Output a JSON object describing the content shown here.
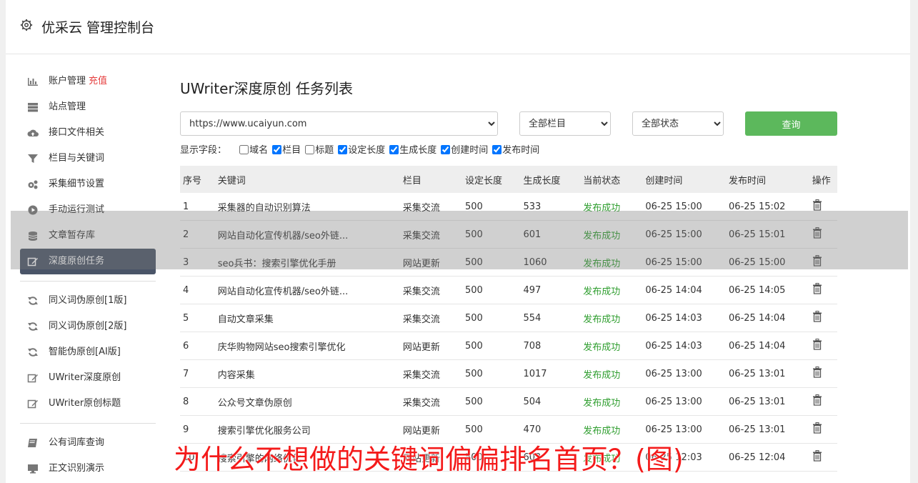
{
  "header": {
    "title": "优采云 管理控制台",
    "icon": "gear-icon"
  },
  "sidebar": {
    "group1": [
      {
        "label": "账户管理",
        "extra": "充值",
        "icon": "bar-chart-icon"
      },
      {
        "label": "站点管理",
        "icon": "server-icon"
      },
      {
        "label": "接口文件相关",
        "icon": "cloud-upload-icon"
      },
      {
        "label": "栏目与关键词",
        "icon": "filter-icon"
      },
      {
        "label": "采集细节设置",
        "icon": "cogs-icon"
      },
      {
        "label": "手动运行测试",
        "icon": "play-circle-icon"
      },
      {
        "label": "文章暂存库",
        "icon": "database-icon"
      },
      {
        "label": "深度原创任务",
        "icon": "edit-icon",
        "active": true
      }
    ],
    "group2": [
      {
        "label": "同义词伪原创[1版]",
        "icon": "refresh-icon"
      },
      {
        "label": "同义词伪原创[2版]",
        "icon": "refresh-icon"
      },
      {
        "label": "智能伪原创[AI版]",
        "icon": "refresh-icon"
      },
      {
        "label": "UWriter深度原创",
        "icon": "edit-icon"
      },
      {
        "label": "UWriter原创标题",
        "icon": "edit-icon"
      }
    ],
    "group3": [
      {
        "label": "公有词库查询",
        "icon": "book-icon"
      },
      {
        "label": "正文识别演示",
        "icon": "monitor-icon"
      }
    ]
  },
  "main": {
    "title": "UWriter深度原创 任务列表",
    "url_select": "https://www.ucaiyun.com",
    "column_select": "全部栏目",
    "status_select": "全部状态",
    "query_button": "查询",
    "fields_label": "显示字段：",
    "fields": [
      {
        "label": "域名",
        "checked": false
      },
      {
        "label": "栏目",
        "checked": true
      },
      {
        "label": "标题",
        "checked": false
      },
      {
        "label": "设定长度",
        "checked": true
      },
      {
        "label": "生成长度",
        "checked": true
      },
      {
        "label": "创建时间",
        "checked": true
      },
      {
        "label": "发布时间",
        "checked": true
      }
    ],
    "table": {
      "headers": [
        "序号",
        "关键词",
        "栏目",
        "设定长度",
        "生成长度",
        "当前状态",
        "创建时间",
        "发布时间",
        "操作"
      ],
      "rows": [
        [
          "1",
          "采集器的自动识别算法",
          "采集交流",
          "500",
          "533",
          "发布成功",
          "06-25 15:00",
          "06-25 15:02"
        ],
        [
          "2",
          "网站自动化宣传机器/seo外链...",
          "采集交流",
          "500",
          "601",
          "发布成功",
          "06-25 15:00",
          "06-25 15:01"
        ],
        [
          "3",
          "seo兵书：搜索引擎优化手册",
          "网站更新",
          "500",
          "1060",
          "发布成功",
          "06-25 15:00",
          "06-25 15:00"
        ],
        [
          "4",
          "网站自动化宣传机器/seo外链...",
          "采集交流",
          "500",
          "497",
          "发布成功",
          "06-25 14:04",
          "06-25 14:05"
        ],
        [
          "5",
          "自动文章采集",
          "采集交流",
          "500",
          "554",
          "发布成功",
          "06-25 14:03",
          "06-25 14:04"
        ],
        [
          "6",
          "庆华购物网站seo搜索引擎优化",
          "网站更新",
          "500",
          "708",
          "发布成功",
          "06-25 14:03",
          "06-25 14:04"
        ],
        [
          "7",
          "内容采集",
          "采集交流",
          "500",
          "1017",
          "发布成功",
          "06-25 13:00",
          "06-25 13:01"
        ],
        [
          "8",
          "公众号文章伪原创",
          "采集交流",
          "500",
          "504",
          "发布成功",
          "06-25 13:00",
          "06-25 13:01"
        ],
        [
          "9",
          "搜索引擎优化服务公司",
          "网站更新",
          "500",
          "470",
          "发布成功",
          "06-25 13:00",
          "06-25 13:01"
        ],
        [
          "10",
          "搜索引擎的网络优化",
          "网站更新",
          "500",
          "602",
          "发布成功",
          "06-25 12:03",
          "06-25 12:04"
        ]
      ]
    }
  },
  "banner": "为什么不想做的关键词偏偏排名首页？(图)"
}
